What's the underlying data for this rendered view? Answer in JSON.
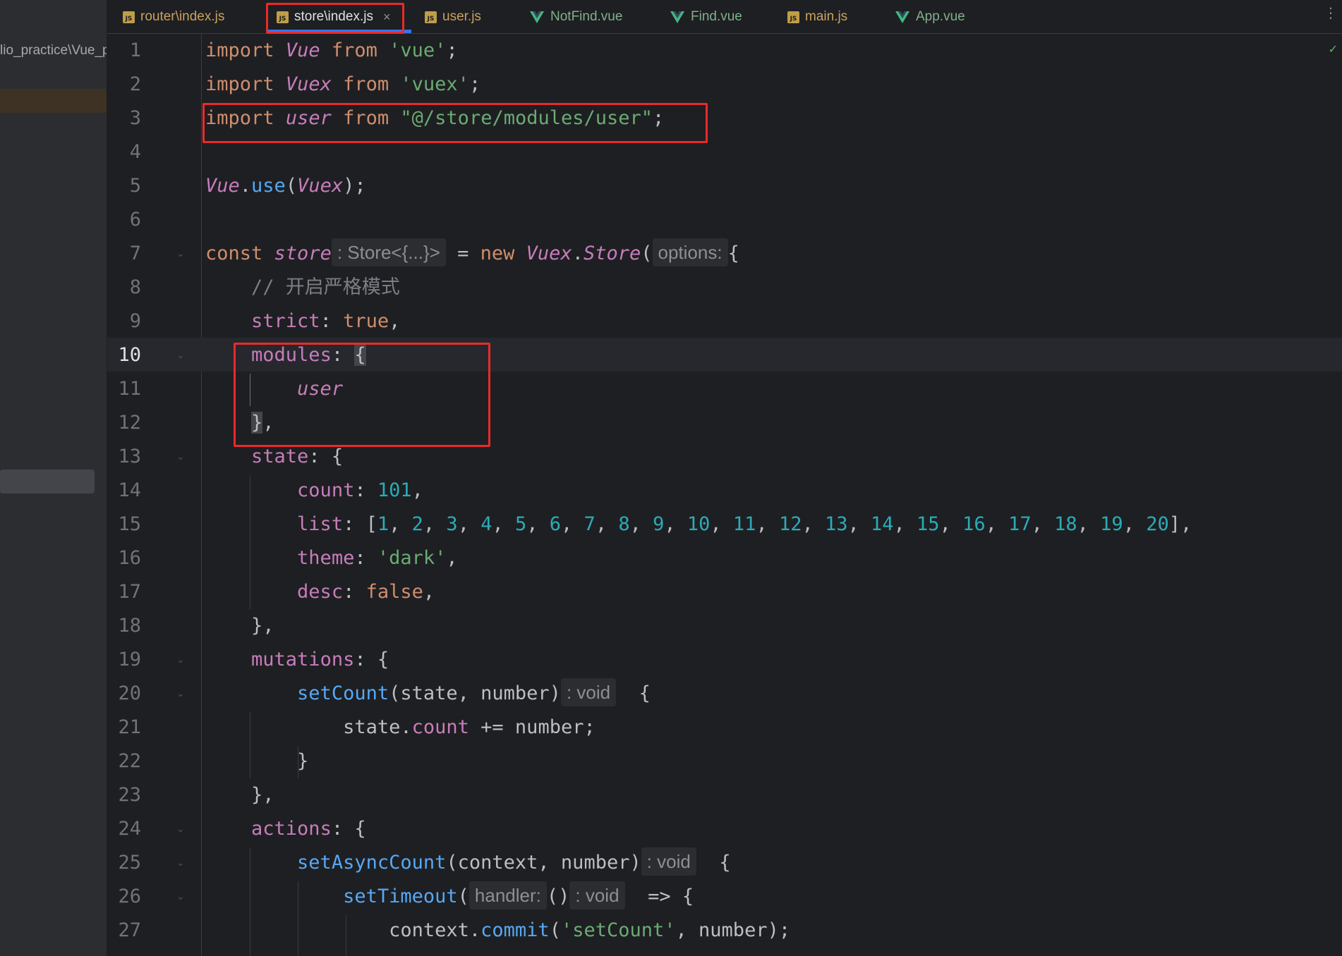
{
  "project_panel": {
    "path_text": "lio_practice\\Vue_p"
  },
  "tabs": [
    {
      "label": "router\\index.js",
      "type": "js",
      "active": false
    },
    {
      "label": "store\\index.js",
      "type": "js",
      "active": true
    },
    {
      "label": "user.js",
      "type": "js",
      "active": false
    },
    {
      "label": "NotFind.vue",
      "type": "vue",
      "active": false
    },
    {
      "label": "Find.vue",
      "type": "vue",
      "active": false
    },
    {
      "label": "main.js",
      "type": "js",
      "active": false
    },
    {
      "label": "App.vue",
      "type": "vue",
      "active": false
    }
  ],
  "icons": {
    "js_icon_text": "JS",
    "close": "×",
    "menu": "⋮",
    "check": "✓"
  },
  "editor": {
    "current_line": 10,
    "line_numbers": [
      "1",
      "2",
      "3",
      "4",
      "5",
      "6",
      "7",
      "8",
      "9",
      "10",
      "11",
      "12",
      "13",
      "14",
      "15",
      "16",
      "17",
      "18",
      "19",
      "20",
      "21",
      "22",
      "23",
      "24",
      "25",
      "26",
      "27"
    ],
    "code": {
      "l1": {
        "kw1": "import",
        "name": "Vue",
        "kw2": "from",
        "str": "'vue'",
        "end": ";"
      },
      "l2": {
        "kw1": "import",
        "name": "Vuex",
        "kw2": "from",
        "str": "'vuex'",
        "end": ";"
      },
      "l3": {
        "kw1": "import",
        "name": "user",
        "kw2": "from",
        "str": "\"@/store/modules/user\"",
        "end": ";"
      },
      "l5": {
        "obj": "Vue",
        "dot": ".",
        "fn": "use",
        "open": "(",
        "arg": "Vuex",
        "close": ");"
      },
      "l7": {
        "kw": "const",
        "name": "store",
        "hint": ": Store<{...}>",
        "eq": " = ",
        "kw_new": "new",
        "cls": "Vuex",
        "dot": ".",
        "ctor": "Store",
        "open": "(",
        "hint_opts": "options:",
        "brace": "{"
      },
      "l8": {
        "comment": "// 开启严格模式"
      },
      "l9": {
        "prop": "strict",
        "colon": ": ",
        "val": "true",
        "end": ","
      },
      "l10": {
        "prop": "modules",
        "colon": ": ",
        "brace": "{"
      },
      "l11": {
        "name": "user"
      },
      "l12": {
        "brace": "}",
        "end": ","
      },
      "l13": {
        "prop": "state",
        "colon": ": ",
        "brace": "{"
      },
      "l14": {
        "prop": "count",
        "colon": ": ",
        "val": "101",
        "end": ","
      },
      "l15": {
        "prop": "list",
        "colon": ": ",
        "open": "[",
        "nums": [
          "1",
          "2",
          "3",
          "4",
          "5",
          "6",
          "7",
          "8",
          "9",
          "10",
          "11",
          "12",
          "13",
          "14",
          "15",
          "16",
          "17",
          "18",
          "19",
          "20"
        ],
        "close": "],"
      },
      "l16": {
        "prop": "theme",
        "colon": ": ",
        "val": "'dark'",
        "end": ","
      },
      "l17": {
        "prop": "desc",
        "colon": ": ",
        "val": "false",
        "end": ","
      },
      "l18": {
        "text": "},"
      },
      "l19": {
        "prop": "mutations",
        "colon": ": ",
        "brace": "{"
      },
      "l20": {
        "fn": "setCount",
        "params": "(state, number)",
        "hint": ": void",
        "brace": "{"
      },
      "l21": {
        "obj": "state",
        "dot": ".",
        "prop": "count",
        "rest": " += number;"
      },
      "l22": {
        "text": "}"
      },
      "l23": {
        "text": "},"
      },
      "l24": {
        "prop": "actions",
        "colon": ": ",
        "brace": "{"
      },
      "l25": {
        "fn": "setAsyncCount",
        "params": "(context, number)",
        "hint": ": void",
        "brace": "{"
      },
      "l26": {
        "fn": "setTimeout",
        "open": "(",
        "hint_handler": "handler:",
        "parens": "()",
        "hint": ": void",
        "arrow": "=> {"
      },
      "l27": {
        "obj": "context",
        "dot": ".",
        "fn": "commit",
        "open": "(",
        "str": "'setCount'",
        "rest": ", number);"
      }
    }
  }
}
